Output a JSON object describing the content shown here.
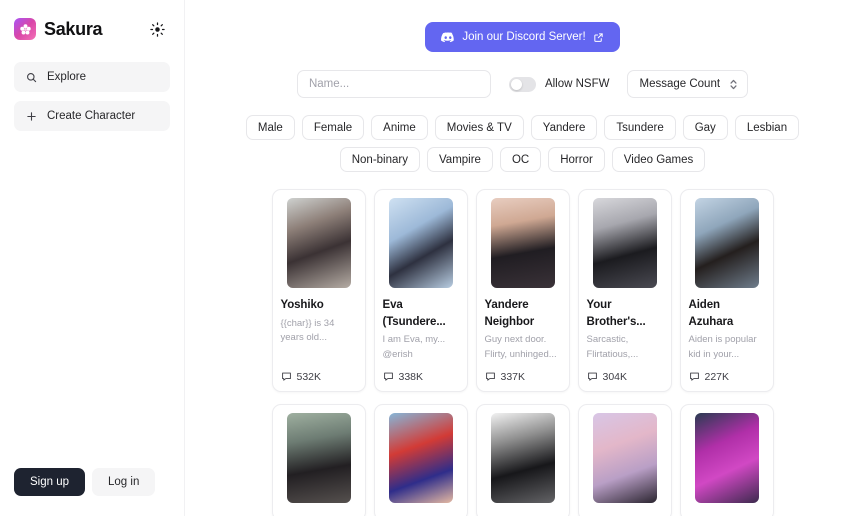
{
  "sidebar": {
    "brand": {
      "name": "Sakura",
      "logo_icon": "sakura-flower-icon"
    },
    "theme_toggle": {
      "icon": "sun-icon"
    },
    "items": [
      {
        "label": "Explore",
        "icon": "search-icon"
      },
      {
        "label": "Create Character",
        "icon": "plus-icon"
      }
    ],
    "auth": {
      "signup_label": "Sign up",
      "login_label": "Log in"
    }
  },
  "header": {
    "discord": {
      "label": "Join our Discord Server!",
      "icon": "discord-icon",
      "external_icon": "external-link-icon",
      "color": "#6366f1"
    }
  },
  "filters": {
    "search": {
      "placeholder": "Name...",
      "value": ""
    },
    "nsfw": {
      "label": "Allow NSFW",
      "enabled": false
    },
    "sort": {
      "label": "Message Count",
      "icon": "chevron-updown-icon"
    },
    "tags": [
      "Male",
      "Female",
      "Anime",
      "Movies & TV",
      "Yandere",
      "Tsundere",
      "Gay",
      "Lesbian",
      "Non-binary",
      "Vampire",
      "OC",
      "Horror",
      "Video Games"
    ]
  },
  "grid": {
    "message_icon": "message-bubble-icon",
    "cards": [
      {
        "name": "Yoshiko",
        "description": "{{char}} is 34 years old...",
        "author": "",
        "count": "532K",
        "thumb": "linear-gradient(160deg,#cfd2d0 0%,#8d7f78 30%,#3b3234 58%,#b5aca4 100%)"
      },
      {
        "name": "Eva (Tsundere...",
        "description": "I am Eva, my...",
        "author": "@erish",
        "count": "338K",
        "thumb": "linear-gradient(150deg,#cfe1f2 0%,#9db9d8 35%,#2e3140 62%,#b8cde2 100%)"
      },
      {
        "name": "Yandere Neighbor",
        "description": "Guy next door. Flirty, unhinged...",
        "author": "",
        "count": "337K",
        "thumb": "linear-gradient(170deg,#e8cdc0 0%,#cfa893 28%,#201d22 60%,#3a3238 100%)"
      },
      {
        "name": "Your Brother's...",
        "description": "Sarcastic, Flirtatious,...",
        "author": "",
        "count": "304K",
        "thumb": "linear-gradient(165deg,#d8d8dc 0%,#a7a7ae 30%,#1b1b1f 62%,#4a4a52 100%)"
      },
      {
        "name": "Aiden Azuhara",
        "description": "Aiden is popular kid in your...",
        "author": "",
        "count": "227K",
        "thumb": "linear-gradient(155deg,#c3d4e4 0%,#8fa6bb 32%,#241f1e 60%,#6f7d8c 100%)"
      },
      {
        "name": "",
        "description": "",
        "author": "",
        "count": "",
        "thumb": "linear-gradient(170deg,#9fb0a0 0%,#6d7c73 30%,#221f22 62%,#55504e 100%)"
      },
      {
        "name": "",
        "description": "",
        "author": "",
        "count": "",
        "thumb": "linear-gradient(160deg,#86b6d8 0%,#d23b36 38%,#2f2d8a 70%,#e5b9a2 100%)"
      },
      {
        "name": "",
        "description": "",
        "author": "",
        "count": "",
        "thumb": "linear-gradient(165deg,#f2f2f2 0%,#8f8f8f 30%,#17171a 62%,#636366 100%)"
      },
      {
        "name": "",
        "description": "",
        "author": "",
        "count": "",
        "thumb": "linear-gradient(160deg,#d8c6e6 0%,#e3b7c9 35%,#b99fc6 65%,#2b2530 100%)"
      },
      {
        "name": "",
        "description": "",
        "author": "",
        "count": "",
        "thumb": "linear-gradient(155deg,#2a3b52 0%,#b02fa8 35%,#d148c4 62%,#3d2a4e 100%)"
      }
    ]
  }
}
